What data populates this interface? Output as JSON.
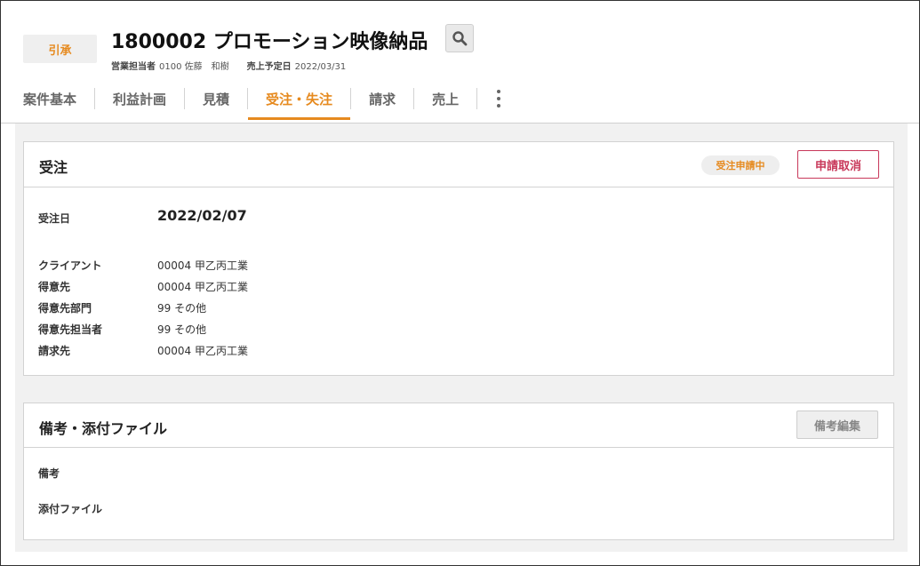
{
  "header": {
    "status": "引承",
    "title": "1800002 プロモーション映像納品",
    "sales_rep_label": "営業担当者",
    "sales_rep_value": "0100 佐藤　和樹",
    "sales_date_label": "売上予定日",
    "sales_date_value": "2022/03/31"
  },
  "tabs": [
    {
      "label": "案件基本"
    },
    {
      "label": "利益計画"
    },
    {
      "label": "見積"
    },
    {
      "label": "受注・失注",
      "active": true
    },
    {
      "label": "請求"
    },
    {
      "label": "売上"
    }
  ],
  "order_card": {
    "title": "受注",
    "status_badge": "受注申請中",
    "cancel_button": "申請取消",
    "fields": [
      {
        "label": "受注日",
        "value": "2022/02/07"
      },
      {
        "label": "クライアント",
        "value": "00004 甲乙丙工業"
      },
      {
        "label": "得意先",
        "value": "00004 甲乙丙工業"
      },
      {
        "label": "得意先部門",
        "value": "99 その他"
      },
      {
        "label": "得意先担当者",
        "value": "99 その他"
      },
      {
        "label": "請求先",
        "value": "00004 甲乙丙工業"
      }
    ]
  },
  "notes_card": {
    "title": "備考・添付ファイル",
    "edit_button": "備考編集",
    "fields": [
      {
        "label": "備考",
        "value": ""
      },
      {
        "label": "添付ファイル",
        "value": ""
      }
    ]
  },
  "icons": {
    "search": "search-icon",
    "more": "more-vertical-icon"
  },
  "colors": {
    "accent": "#e68a1f",
    "danger": "#c8385a"
  }
}
